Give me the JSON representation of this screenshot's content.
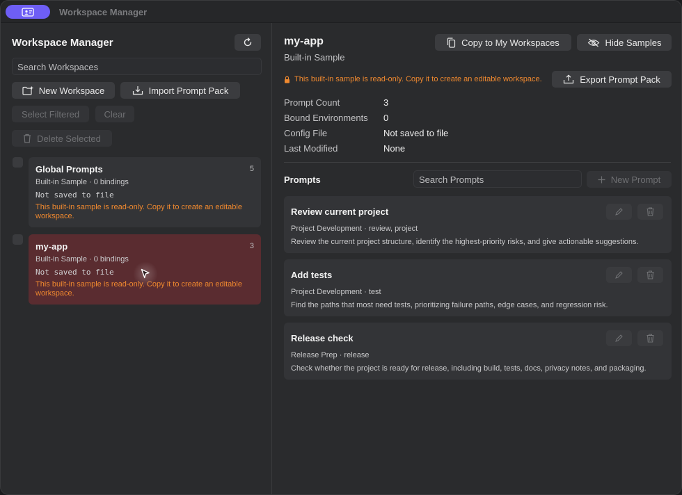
{
  "window": {
    "title": "Workspace Manager"
  },
  "sidebar": {
    "title": "Workspace Manager",
    "search_placeholder": "Search Workspaces",
    "new_workspace": "New Workspace",
    "import_prompt_pack": "Import Prompt Pack",
    "select_filtered": "Select Filtered",
    "clear": "Clear",
    "delete_selected": "Delete Selected",
    "workspaces": [
      {
        "name": "Global Prompts",
        "count": "5",
        "subtitle": "Built-in Sample · 0 bindings",
        "file": "Not saved to file",
        "warning": "This built-in sample is read-only. Copy it to create an editable workspace."
      },
      {
        "name": "my-app",
        "count": "3",
        "subtitle": "Built-in Sample · 0 bindings",
        "file": "Not saved to file",
        "warning": "This built-in sample is read-only. Copy it to create an editable workspace."
      }
    ]
  },
  "main": {
    "title": "my-app",
    "subtitle": "Built-in Sample",
    "copy_button": "Copy to My Workspaces",
    "hide_samples_button": "Hide Samples",
    "export_button": "Export Prompt Pack",
    "readonly_warning": "This built-in sample is read-only. Copy it to create an editable workspace.",
    "meta": [
      {
        "label": "Prompt Count",
        "value": "3"
      },
      {
        "label": "Bound Environments",
        "value": "0"
      },
      {
        "label": "Config File",
        "value": "Not saved to file"
      },
      {
        "label": "Last Modified",
        "value": "None"
      }
    ],
    "prompts_heading": "Prompts",
    "prompts_search_placeholder": "Search Prompts",
    "new_prompt": "New Prompt",
    "prompts": [
      {
        "title": "Review current project",
        "tags": "Project Development · review, project",
        "description": "Review the current project structure, identify the highest-priority risks, and give actionable suggestions."
      },
      {
        "title": "Add tests",
        "tags": "Project Development · test",
        "description": "Find the paths that most need tests, prioritizing failure paths, edge cases, and regression risk."
      },
      {
        "title": "Release check",
        "tags": "Release Prep · release",
        "description": "Check whether the project is ready for release, including build, tests, docs, privacy notes, and packaging."
      }
    ]
  },
  "colors": {
    "accent": "#6e5ef5",
    "warning": "#f0892f",
    "selected": "#5a2c30"
  }
}
